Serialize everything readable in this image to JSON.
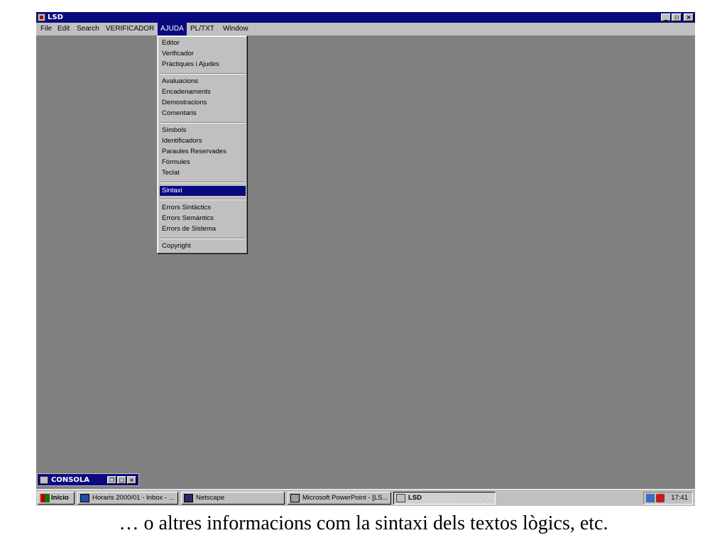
{
  "window": {
    "title": "LSD",
    "minimize_label": "_",
    "restore_label": "▫",
    "close_label": "×"
  },
  "menubar": {
    "items": [
      {
        "label": "File"
      },
      {
        "label": "Edit"
      },
      {
        "label": "Search"
      },
      {
        "label": "VERIFICADOR"
      },
      {
        "label": "AJUDA"
      },
      {
        "label": "PL/TXT"
      },
      {
        "label": "Window"
      }
    ]
  },
  "ajuda_menu": {
    "items": [
      {
        "label": "Editor"
      },
      {
        "label": "Verificador"
      },
      {
        "label": "Pràctiques i Ajudes"
      },
      {
        "label": "Avaluacions"
      },
      {
        "label": "Encadenaments"
      },
      {
        "label": "Demostracions"
      },
      {
        "label": "Comentaris"
      },
      {
        "label": "Símbols"
      },
      {
        "label": "Identificadors"
      },
      {
        "label": "Paraules Reservades"
      },
      {
        "label": "Fórmules"
      },
      {
        "label": "Teclat"
      },
      {
        "label": "Sintaxi"
      },
      {
        "label": "Errors Sintàctics"
      },
      {
        "label": "Errors Semàntics"
      },
      {
        "label": "Errors de Sistema"
      },
      {
        "label": "Copyright"
      }
    ],
    "highlighted": "Sintaxi"
  },
  "console": {
    "title": "CONSOLA"
  },
  "taskbar": {
    "start_label": "Inicio",
    "tasks": [
      {
        "label": "Horaris 2000/01 - Inbox - ..."
      },
      {
        "label": "Netscape"
      },
      {
        "label": "Microsoft PowerPoint - [LS..."
      },
      {
        "label": "LSD"
      }
    ],
    "clock": "17:41"
  },
  "caption": "… o altres informacions com la sintaxi dels textos lògics, etc.",
  "colors": {
    "desktop": "#808080",
    "titlebar": "#0a0a80",
    "chrome": "#c0c0c0",
    "highlight": "#0a0a80"
  }
}
